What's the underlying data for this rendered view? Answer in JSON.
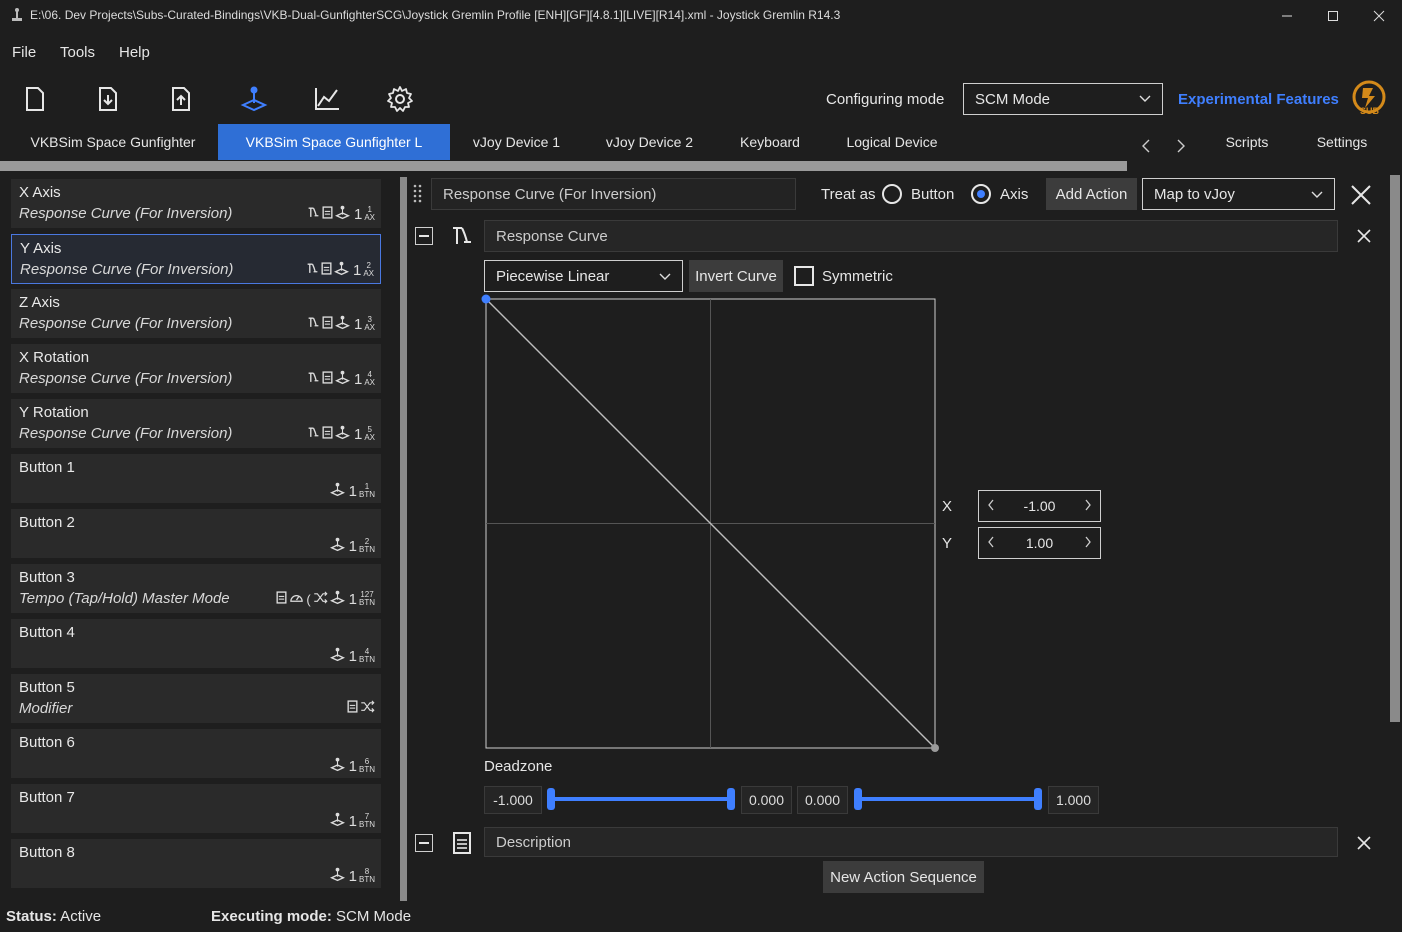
{
  "window": {
    "title": "E:\\06. Dev Projects\\Subs-Curated-Bindings\\VKB-Dual-GunfighterSCG\\Joystick Gremlin Profile [ENH][GF][4.8.1][LIVE][R14].xml - Joystick Gremlin R14.3"
  },
  "menu": [
    "File",
    "Tools",
    "Help"
  ],
  "toolbar": {
    "configuring_label": "Configuring mode",
    "mode_value": "SCM Mode",
    "experimental": "Experimental Features",
    "logo_text": "SUB"
  },
  "tabs": [
    "VKBSim Space Gunfighter",
    "VKBSim Space Gunfighter  L",
    "vJoy Device 1",
    "vJoy Device 2",
    "Keyboard",
    "Logical Device"
  ],
  "right_tabs": [
    "Scripts",
    "Settings"
  ],
  "inputs": [
    {
      "name": "X Axis",
      "desc": "Response Curve (For Inversion)",
      "count": "1",
      "sub_top": "1",
      "sub_bot": "AX"
    },
    {
      "name": "Y Axis",
      "desc": "Response Curve (For Inversion)",
      "count": "1",
      "sub_top": "2",
      "sub_bot": "AX"
    },
    {
      "name": "Z Axis",
      "desc": "Response Curve (For Inversion)",
      "count": "1",
      "sub_top": "3",
      "sub_bot": "AX"
    },
    {
      "name": "X Rotation",
      "desc": "Response Curve (For Inversion)",
      "count": "1",
      "sub_top": "4",
      "sub_bot": "AX"
    },
    {
      "name": "Y Rotation",
      "desc": "Response Curve (For Inversion)",
      "count": "1",
      "sub_top": "5",
      "sub_bot": "AX"
    },
    {
      "name": "Button 1",
      "desc": "",
      "count": "1",
      "sub_top": "1",
      "sub_bot": "BTN"
    },
    {
      "name": "Button 2",
      "desc": "",
      "count": "1",
      "sub_top": "2",
      "sub_bot": "BTN"
    },
    {
      "name": "Button 3",
      "desc": "Tempo (Tap/Hold) Master Mode",
      "count": "1",
      "sub_top": "127",
      "sub_bot": "BTN"
    },
    {
      "name": "Button 4",
      "desc": "",
      "count": "1",
      "sub_top": "4",
      "sub_bot": "BTN"
    },
    {
      "name": "Button 5",
      "desc": "Modifier",
      "count": "",
      "sub_top": "",
      "sub_bot": ""
    },
    {
      "name": "Button 6",
      "desc": "",
      "count": "1",
      "sub_top": "6",
      "sub_bot": "BTN"
    },
    {
      "name": "Button 7",
      "desc": "",
      "count": "1",
      "sub_top": "7",
      "sub_bot": "BTN"
    },
    {
      "name": "Button 8",
      "desc": "",
      "count": "1",
      "sub_top": "8",
      "sub_bot": "BTN"
    }
  ],
  "editor": {
    "container_title": "Response Curve (For Inversion)",
    "treat_as": "Treat as",
    "opt_button": "Button",
    "opt_axis": "Axis",
    "add_action": "Add Action",
    "map_to": "Map to vJoy",
    "action_title": "Response Curve",
    "curve_type": "Piecewise Linear",
    "invert": "Invert Curve",
    "symmetric": "Symmetric",
    "x_label": "X",
    "y_label": "Y",
    "x_value": "-1.00",
    "y_value": "1.00",
    "deadzone": "Deadzone",
    "dz_values": [
      "-1.000",
      "0.000",
      "0.000",
      "1.000"
    ],
    "description": "Description",
    "new_sequence": "New Action Sequence"
  },
  "status": {
    "status_label": "Status:",
    "status_value": " Active",
    "exec_label": "Executing mode:",
    "exec_value": " SCM Mode"
  }
}
